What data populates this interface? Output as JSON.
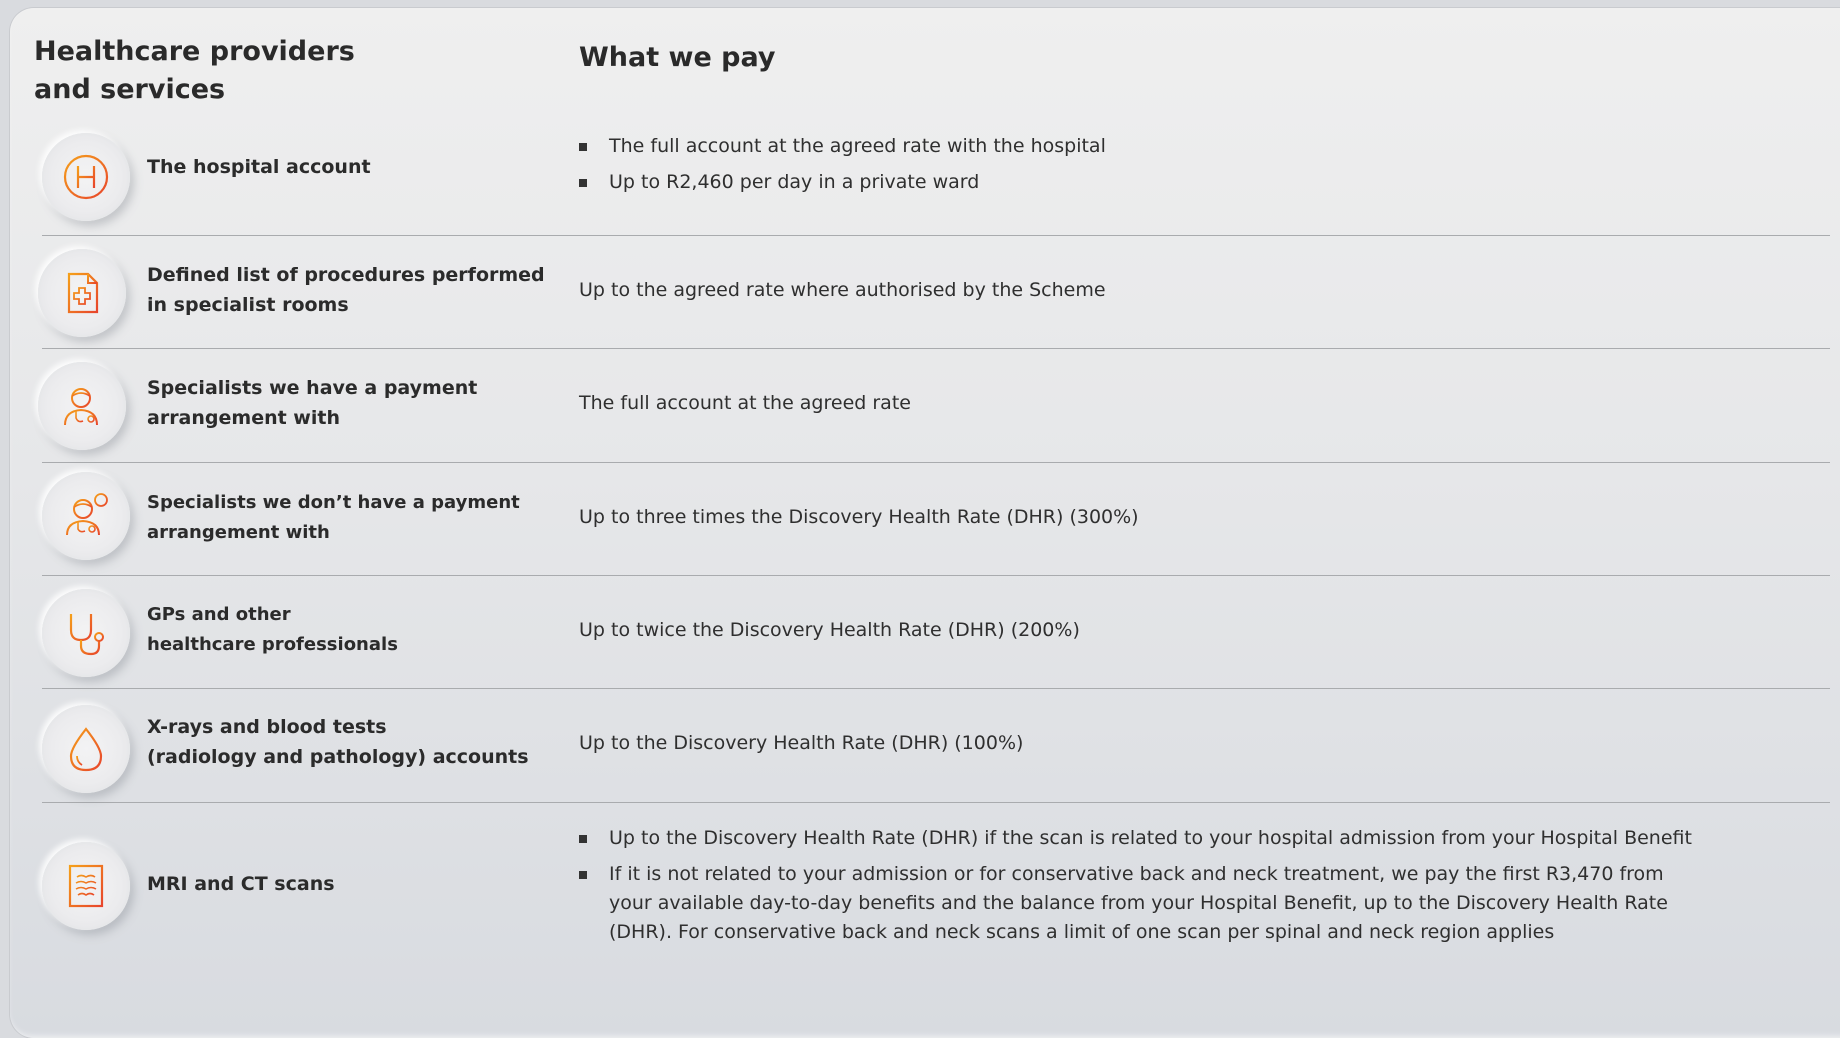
{
  "headers": {
    "providers_line1": "Healthcare providers",
    "providers_line2": "and services",
    "pay": "What we pay"
  },
  "accent_colors": [
    "#f5a01a",
    "#e8452c"
  ],
  "rows": [
    {
      "icon": "hospital-icon",
      "label_lines": [
        "The hospital account"
      ],
      "pay_bullets": [
        "The full account at the agreed rate with the hospital",
        "Up to R2,460 per day in a private ward"
      ]
    },
    {
      "icon": "medical-document-icon",
      "label_lines": [
        "Defined list of procedures performed",
        "in specialist rooms"
      ],
      "pay_text": "Up to the agreed rate where authorised by the Scheme"
    },
    {
      "icon": "doctor-icon",
      "label_lines": [
        "Specialists we have a payment",
        "arrangement with"
      ],
      "pay_text": "The full account at the agreed rate"
    },
    {
      "icon": "doctor-minus-icon",
      "label_lines": [
        "Specialists we don’t have a payment",
        "arrangement with"
      ],
      "pay_text": "Up to three times the Discovery Health Rate (DHR) (300%)"
    },
    {
      "icon": "stethoscope-icon",
      "label_lines": [
        "GPs and other",
        "healthcare professionals"
      ],
      "pay_text": "Up to twice the Discovery Health Rate (DHR) (200%)"
    },
    {
      "icon": "blood-drop-icon",
      "label_lines": [
        "X-rays and blood tests",
        "(radiology and pathology) accounts"
      ],
      "pay_text": "Up to the Discovery Health Rate (DHR) (100%)"
    },
    {
      "icon": "scan-icon",
      "label_lines": [
        "MRI and CT scans"
      ],
      "pay_bullets": [
        "Up to the Discovery Health Rate (DHR) if the scan is related to your hospital admission from your Hospital Benefit",
        "If it is not related to your admission or for conservative back and neck treatment, we pay the first R3,470 from your available day-to-day benefits and the balance from your Hospital Benefit, up to the Discovery Health Rate (DHR). For conservative back and neck scans a limit of one scan per spinal and neck region applies"
      ]
    }
  ]
}
